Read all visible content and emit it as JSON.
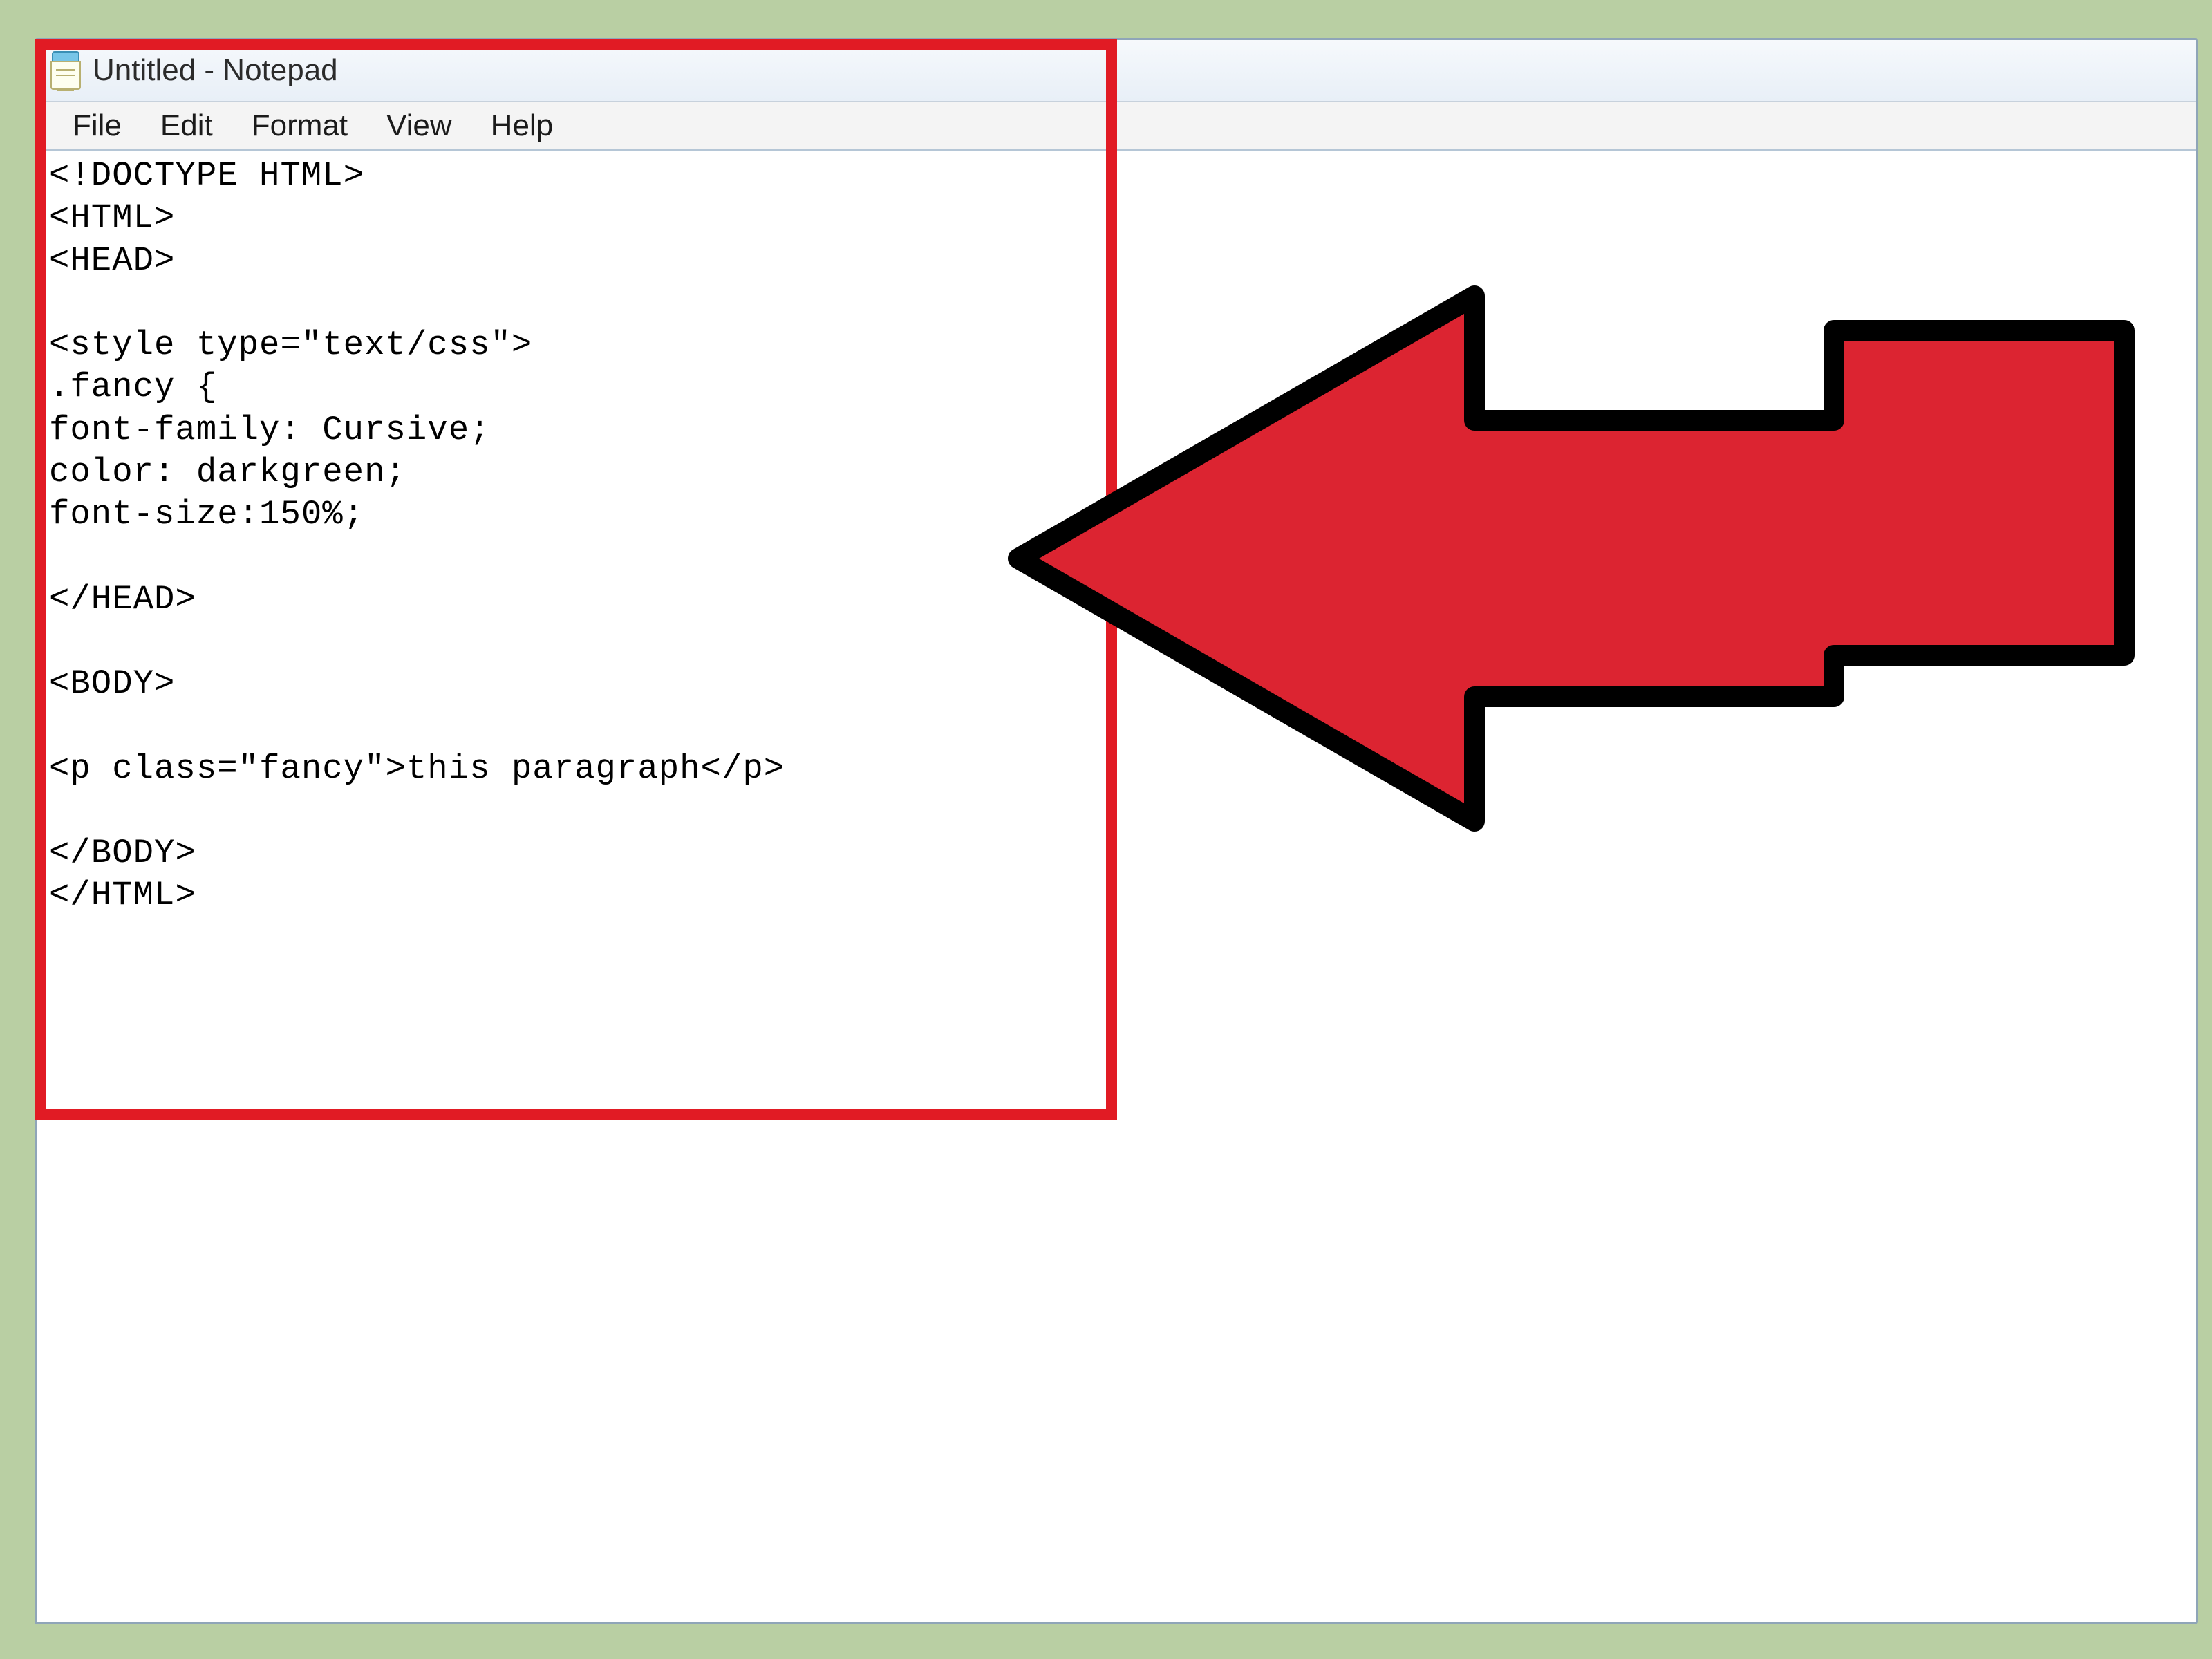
{
  "window": {
    "title": "Untitled - Notepad"
  },
  "menubar": {
    "items": [
      "File",
      "Edit",
      "Format",
      "View",
      "Help"
    ]
  },
  "editor": {
    "content": "<!DOCTYPE HTML>\n<HTML>\n<HEAD>\n\n<style type=\"text/css\">\n.fancy {\nfont-family: Cursive;\ncolor: darkgreen;\nfont-size:150%;\n\n</HEAD>\n\n<BODY>\n\n<p class=\"fancy\">this paragraph</p>\n\n</BODY>\n</HTML>"
  },
  "annotation": {
    "highlight_color": "#e11b24",
    "arrow_color": "#dc2431"
  }
}
